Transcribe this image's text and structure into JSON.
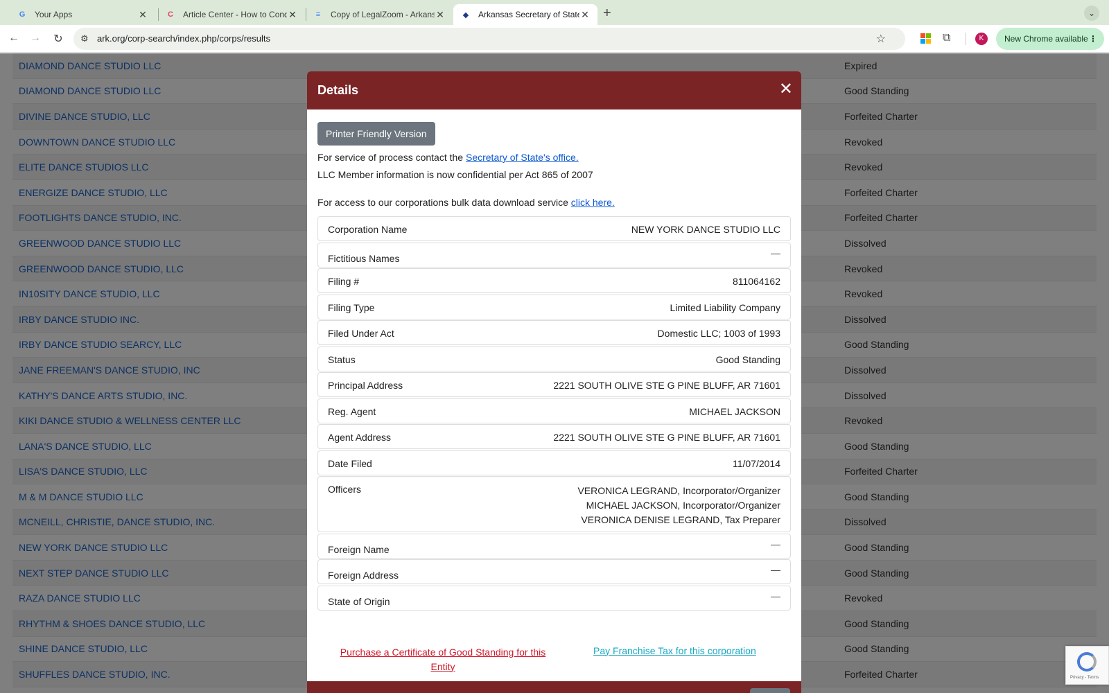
{
  "browser": {
    "tabs": [
      {
        "title": "Your Apps",
        "favicon": "G",
        "favicon_color": "#4285f4"
      },
      {
        "title": "Article Center - How to Cond",
        "favicon": "C",
        "favicon_color": "#e2445c"
      },
      {
        "title": "Copy of LegalZoom - Arkansa",
        "favicon": "≡",
        "favicon_color": "#4285f4"
      },
      {
        "title": "Arkansas Secretary of State",
        "favicon": "◆",
        "favicon_color": "#1e3a8a"
      }
    ],
    "url": "ark.org/corp-search/index.php/corps/results",
    "update_label": "New Chrome available",
    "avatar_initial": "K"
  },
  "results": [
    {
      "name": "DIAMOND DANCE STUDIO LLC",
      "status": "Expired"
    },
    {
      "name": "DIAMOND DANCE STUDIO LLC",
      "status": "Good Standing"
    },
    {
      "name": "DIVINE DANCE STUDIO, LLC",
      "status": "Forfeited Charter"
    },
    {
      "name": "DOWNTOWN DANCE STUDIO LLC",
      "status": "Revoked"
    },
    {
      "name": "ELITE DANCE STUDIOS LLC",
      "status": "Revoked"
    },
    {
      "name": "ENERGIZE DANCE STUDIO, LLC",
      "status": "Forfeited Charter"
    },
    {
      "name": "FOOTLIGHTS DANCE STUDIO, INC.",
      "status": "Forfeited Charter"
    },
    {
      "name": "GREENWOOD DANCE STUDIO LLC",
      "status": "Dissolved"
    },
    {
      "name": "GREENWOOD DANCE STUDIO, LLC",
      "status": "Revoked"
    },
    {
      "name": "IN10SITY DANCE STUDIO, LLC",
      "status": "Revoked"
    },
    {
      "name": "IRBY DANCE STUDIO INC.",
      "status": "Dissolved"
    },
    {
      "name": "IRBY DANCE STUDIO SEARCY, LLC",
      "status": "Good Standing"
    },
    {
      "name": "JANE FREEMAN'S DANCE STUDIO, INC",
      "status": "Dissolved"
    },
    {
      "name": "KATHY'S DANCE ARTS STUDIO, INC.",
      "status": "Dissolved"
    },
    {
      "name": "KIKI DANCE STUDIO & WELLNESS CENTER LLC",
      "status": "Revoked"
    },
    {
      "name": "LANA'S DANCE STUDIO, LLC",
      "status": "Good Standing"
    },
    {
      "name": "LISA'S DANCE STUDIO, LLC",
      "status": "Forfeited Charter"
    },
    {
      "name": "M & M DANCE STUDIO LLC",
      "status": "Good Standing"
    },
    {
      "name": "MCNEILL, CHRISTIE, DANCE STUDIO, INC.",
      "status": "Dissolved"
    },
    {
      "name": "NEW YORK DANCE STUDIO LLC",
      "status": "Good Standing"
    },
    {
      "name": "NEXT STEP DANCE STUDIO LLC",
      "status": "Good Standing"
    },
    {
      "name": "RAZA DANCE STUDIO LLC",
      "status": "Revoked"
    },
    {
      "name": "RHYTHM & SHOES DANCE STUDIO, LLC",
      "status": "Good Standing"
    },
    {
      "name": "SHINE DANCE STUDIO, LLC",
      "status": "Good Standing"
    },
    {
      "name": "SHUFFLES DANCE STUDIO, INC.",
      "status": "Forfeited Charter"
    }
  ],
  "modal": {
    "title": "Details",
    "printer_button": "Printer Friendly Version",
    "service_text": "For service of process contact the",
    "service_link": "Secretary of State's office.",
    "llc_notice": "LLC Member information is now confidential per Act 865 of 2007",
    "bulk_text": "For access to our corporations bulk data download service",
    "bulk_link": "click here.",
    "fields": {
      "corporation_name": {
        "label": "Corporation Name",
        "value": "NEW YORK DANCE STUDIO LLC"
      },
      "fictitious_names": {
        "label": "Fictitious Names",
        "value": "—"
      },
      "filing_number": {
        "label": "Filing #",
        "value": "811064162"
      },
      "filing_type": {
        "label": "Filing Type",
        "value": "Limited Liability Company"
      },
      "filed_under_act": {
        "label": "Filed Under Act",
        "value": "Domestic LLC; 1003 of 1993"
      },
      "status": {
        "label": "Status",
        "value": "Good Standing"
      },
      "principal_address": {
        "label": "Principal Address",
        "value": "2221 SOUTH OLIVE STE G PINE BLUFF, AR 71601"
      },
      "reg_agent": {
        "label": "Reg. Agent",
        "value": "MICHAEL JACKSON"
      },
      "agent_address": {
        "label": "Agent Address",
        "value": "2221 SOUTH OLIVE STE G PINE BLUFF, AR 71601"
      },
      "date_filed": {
        "label": "Date Filed",
        "value": "11/07/2014"
      },
      "officers": {
        "label": "Officers",
        "values": [
          "VERONICA LEGRAND, Incorporator/Organizer",
          "MICHAEL JACKSON, Incorporator/Organizer",
          "VERONICA DENISE LEGRAND, Tax Preparer"
        ]
      },
      "foreign_name": {
        "label": "Foreign Name",
        "value": "—"
      },
      "foreign_address": {
        "label": "Foreign Address",
        "value": "—"
      },
      "state_of_origin": {
        "label": "State of Origin",
        "value": "—"
      }
    },
    "purchase_link": "Purchase a Certificate of Good Standing for this Entity",
    "franchise_link": "Pay Franchise Tax for this corporation"
  },
  "captcha": {
    "text": "Privacy - Terms"
  },
  "colors": {
    "modal_header": "#7b2426",
    "link": "#1a63c8",
    "danger_link": "#d0182b",
    "info_link": "#17a8c3"
  }
}
